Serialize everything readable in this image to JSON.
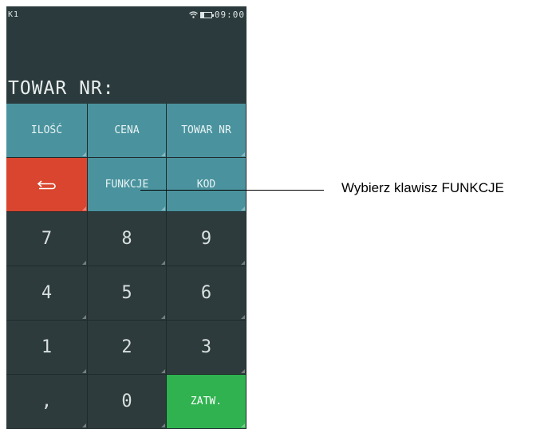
{
  "status": {
    "label": "K1",
    "time": "09:00",
    "icons": [
      "wifi-icon",
      "battery-icon"
    ],
    "battery_level": 0.35
  },
  "screen": {
    "prompt": "TOWAR NR:"
  },
  "keys": {
    "ilosc": "ILOŚĆ",
    "cena": "CENA",
    "towar_nr": "TOWAR NR",
    "back_icon": "back-arrow-icon",
    "funkcje": "FUNKCJE",
    "kod": "KOD",
    "k7": "7",
    "k8": "8",
    "k9": "9",
    "k4": "4",
    "k5": "5",
    "k6": "6",
    "k1": "1",
    "k2": "2",
    "k3": "3",
    "comma": ",",
    "k0": "0",
    "zatw": "ZATW."
  },
  "annotation": {
    "text": "Wybierz klawisz FUNKCJE"
  },
  "colors": {
    "background": "#2b3a3c",
    "function_key": "#4a939e",
    "back_key": "#d9452f",
    "confirm_key": "#2fb24f"
  }
}
